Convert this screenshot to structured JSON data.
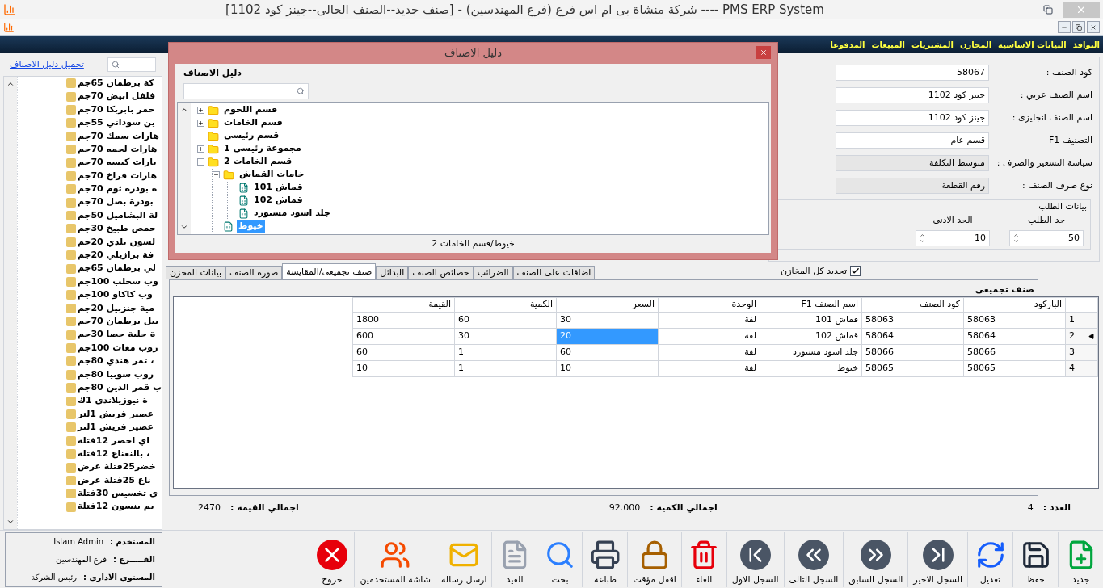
{
  "window": {
    "title": "PMS ERP System ----  شركة منشاة بى ام اس فرع (فرع المهندسين) - [صنف جديد--الصنف الحالى--جينز كود 1102]"
  },
  "menu": [
    {
      "label": "النوافذ"
    },
    {
      "label": "البيانات الاساسية"
    },
    {
      "label": "المخازن"
    },
    {
      "label": "المشتريات"
    },
    {
      "label": "المبيعات"
    },
    {
      "label": "المدفوعا"
    }
  ],
  "sidebar": {
    "link": "تحميل دليل الاصناف",
    "items": [
      "كة برطمان 65جم",
      "فلفل ابيض 70جم",
      "حمر بابريكا 70جم",
      "ين سوداني 55جم",
      "هارات سمك 70جم",
      "هارات لحمه 70جم",
      "بارات كبسه 70جم",
      "هارات فراخ 70جم",
      "ة بودرة ثوم 70جم",
      "بودرة بصل 70جم",
      "لة البشاميل 50جم",
      "حمص طبيخ 30جم",
      "لسون بلدي 20جم",
      "فة برازيلي 20جم",
      "لي برطمان 65جم",
      "وب سحلب 100جم",
      "وب كاكاو 100جم",
      "مية جنزبيل 20جم",
      "بيل برطمان 70جم",
      "ة حلبة حصا 30جم",
      "روب مغات 100جم",
      "، تمر هندي 80جم",
      "روب سوبيا 80جم",
      "ب قمر الدين 80جم",
      "ة نيوزيلاندى 1ك",
      "عصير فريش 1لتر",
      "عصير فريش 1لتر",
      "اي اخضر 12فتلة",
      "، بالنعناع 12فتلة",
      "خضر25فتلة عرض",
      "ناع 25فتلة عرض",
      "ي تخسيس 30فتلة",
      "بم ينسون 12فتلة"
    ]
  },
  "dialog": {
    "title": "دليل الاصناف",
    "label": "دليل الاصناف",
    "path": "خيوط/قسم الخامات 2",
    "tree": [
      {
        "label": "قسم اللحوم",
        "kind": "folder",
        "expanded": false,
        "selected": false
      },
      {
        "label": "قسم الخامات",
        "kind": "folder",
        "expanded": false,
        "selected": false
      },
      {
        "label": "قسم رئيسى",
        "kind": "folder",
        "selected": false
      },
      {
        "label": "مجموعة رئيسى 1",
        "kind": "folder",
        "expanded": false,
        "selected": false
      },
      {
        "label": "قسم الخامات 2",
        "kind": "folder",
        "expanded": true,
        "selected": false,
        "children": [
          {
            "label": "خامات القماش",
            "kind": "folder",
            "expanded": true,
            "selected": false,
            "children": [
              {
                "label": "قماش 101",
                "kind": "item",
                "selected": false
              },
              {
                "label": "قماش 102",
                "kind": "item",
                "selected": false
              },
              {
                "label": "جلد اسود مستورد",
                "kind": "item",
                "selected": false
              }
            ]
          },
          {
            "label": "خيوط",
            "kind": "item",
            "selected": true
          }
        ]
      }
    ]
  },
  "form": {
    "fields": [
      {
        "label": "كود الصنف :",
        "value": "58067",
        "kind": "input"
      },
      {
        "label": "اسم الصنف عربي :",
        "value": "جينز كود 1102",
        "kind": "input"
      },
      {
        "label": "اسم الصنف انجليزى :",
        "value": "جينز كود 1102",
        "kind": "input"
      },
      {
        "label": "التصنيف F1",
        "value": "قسم عام",
        "kind": "input"
      },
      {
        "label": "سياسة التسعير والصرف :",
        "value": "متوسط التكلفة",
        "kind": "readonly"
      },
      {
        "label": "نوع صرف الصنف :",
        "value": "رقم القطعة",
        "kind": "readonly"
      }
    ],
    "order_group": {
      "title": "بيانات الطلب",
      "fields": [
        {
          "label": "حد الطلب",
          "value": "50"
        },
        {
          "label": "الحد الادنى",
          "value": "10"
        }
      ]
    },
    "all_stores": {
      "label": "تحديد كل المخازن",
      "checked": true
    }
  },
  "tabs": [
    {
      "label": "اضافات على الصنف",
      "selected": false
    },
    {
      "label": "الضرائب",
      "selected": false
    },
    {
      "label": "خصائص الصنف",
      "selected": false
    },
    {
      "label": "البدائل",
      "selected": false
    },
    {
      "label": "صنف تجميعى/المقايسة",
      "selected": true
    },
    {
      "label": "صورة الصنف",
      "selected": false
    },
    {
      "label": "بيانات المخزن",
      "selected": false
    }
  ],
  "grid": {
    "title": "صنف تجميعى",
    "columns": [
      "الباركود",
      "كود الصنف",
      "اسم الصنف F1",
      "الوحدة",
      "السعر",
      "الكمية",
      "القيمة"
    ],
    "rows": [
      {
        "number": "1",
        "current": false,
        "cells": [
          {
            "text": "58063",
            "selected": false
          },
          {
            "text": "58063",
            "selected": false
          },
          {
            "text": "قماش 101",
            "selected": false
          },
          {
            "text": "لفة",
            "selected": false
          },
          {
            "text": "30",
            "selected": false
          },
          {
            "text": "60",
            "selected": false
          },
          {
            "text": "1800",
            "selected": false
          }
        ]
      },
      {
        "number": "2",
        "current": true,
        "cells": [
          {
            "text": "58064",
            "selected": false
          },
          {
            "text": "58064",
            "selected": false
          },
          {
            "text": "قماش 102",
            "selected": false
          },
          {
            "text": "لفة",
            "selected": false
          },
          {
            "text": "20",
            "selected": true
          },
          {
            "text": "30",
            "selected": false
          },
          {
            "text": "600",
            "selected": false
          }
        ]
      },
      {
        "number": "3",
        "current": false,
        "cells": [
          {
            "text": "58066",
            "selected": false
          },
          {
            "text": "58066",
            "selected": false
          },
          {
            "text": "جلد اسود مستورد",
            "selected": false
          },
          {
            "text": "لفة",
            "selected": false
          },
          {
            "text": "60",
            "selected": false
          },
          {
            "text": "1",
            "selected": false
          },
          {
            "text": "60",
            "selected": false
          }
        ]
      },
      {
        "number": "4",
        "current": false,
        "cells": [
          {
            "text": "58065",
            "selected": false
          },
          {
            "text": "58065",
            "selected": false
          },
          {
            "text": "خيوط",
            "selected": false
          },
          {
            "text": "لفة",
            "selected": false
          },
          {
            "text": "10",
            "selected": false
          },
          {
            "text": "1",
            "selected": false
          },
          {
            "text": "10",
            "selected": false
          }
        ]
      }
    ]
  },
  "totals": [
    {
      "label": "العدد :",
      "value": "4"
    },
    {
      "label": "اجمالي الكمية :",
      "value": "92.000"
    },
    {
      "label": "اجمالي القيمة :",
      "value": "2470"
    }
  ],
  "toolbar": [
    {
      "label": "جديد",
      "kind": "new"
    },
    {
      "label": "حفظ",
      "kind": "save"
    },
    {
      "label": "تعديل",
      "kind": "edit"
    },
    {
      "label": "السجل الاخير",
      "kind": "last"
    },
    {
      "label": "السجل السابق",
      "kind": "prev"
    },
    {
      "label": "السجل التالى",
      "kind": "next"
    },
    {
      "label": "السجل الاول",
      "kind": "first"
    },
    {
      "label": "الغاء",
      "kind": "delete"
    },
    {
      "label": "اقفل مؤقت",
      "kind": "lock"
    },
    {
      "label": "طباعة",
      "kind": "print"
    },
    {
      "label": "بحث",
      "kind": "search"
    },
    {
      "label": "القيد",
      "kind": "journal"
    },
    {
      "label": "ارسل رسالة",
      "kind": "mail"
    },
    {
      "label": "شاشة المستخدمين",
      "kind": "users"
    },
    {
      "label": "خروج",
      "kind": "exit"
    }
  ],
  "user_info": [
    {
      "label": "المستخدم :",
      "value": "Islam Admin"
    },
    {
      "label": "الفـــــرع :",
      "value": "فرع المهندسين"
    },
    {
      "label": "المستوى الادارى :",
      "value": "رئيس الشركة"
    }
  ]
}
